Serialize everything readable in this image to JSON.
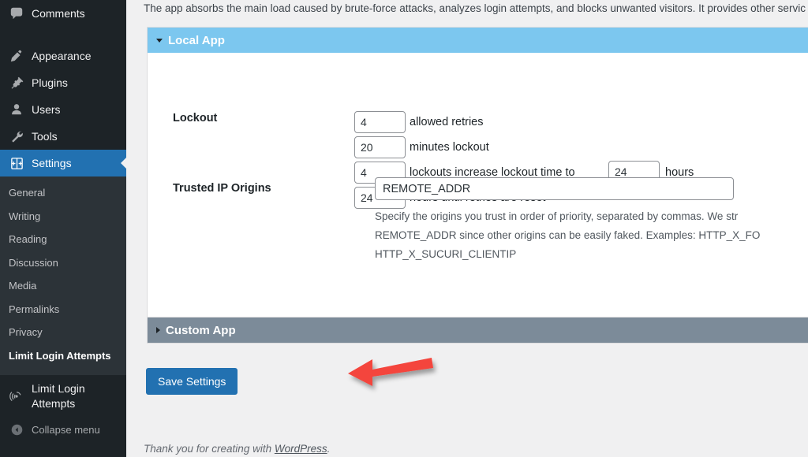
{
  "sidebar": {
    "items": [
      {
        "label": "Comments",
        "icon": "comments-icon"
      },
      {
        "label": "Appearance",
        "icon": "appearance-icon"
      },
      {
        "label": "Plugins",
        "icon": "plugins-icon"
      },
      {
        "label": "Users",
        "icon": "users-icon"
      },
      {
        "label": "Tools",
        "icon": "tools-icon"
      },
      {
        "label": "Settings",
        "icon": "settings-icon"
      }
    ],
    "submenu": [
      {
        "label": "General"
      },
      {
        "label": "Writing"
      },
      {
        "label": "Reading"
      },
      {
        "label": "Discussion"
      },
      {
        "label": "Media"
      },
      {
        "label": "Permalinks"
      },
      {
        "label": "Privacy"
      },
      {
        "label": "Limit Login Attempts"
      }
    ],
    "plugin_menu": {
      "label": "Limit Login Attempts",
      "icon": "fingerprint-icon"
    },
    "collapse": {
      "label": "Collapse menu",
      "icon": "collapse-arrow-icon"
    },
    "active_item": "Settings",
    "current_submenu": "Limit Login Attempts",
    "accent": "#2271b1",
    "background": "#1d2327"
  },
  "main": {
    "intro": "The app absorbs the main load caused by brute-force attacks, analyzes login attempts, and blocks unwanted visitors. It provides other servic",
    "panels": [
      {
        "title": "Local App",
        "state": "expanded",
        "header_color": "#7cc7ef",
        "toggle_icon": "chevron-down-icon"
      },
      {
        "title": "Custom App",
        "state": "collapsed",
        "header_color": "#7c8b99",
        "toggle_icon": "chevron-right-icon"
      }
    ],
    "lockout": {
      "label": "Lockout",
      "rows": [
        {
          "value": "4",
          "text_after": "allowed retries"
        },
        {
          "value": "20",
          "text_after": "minutes lockout"
        },
        {
          "value": "4",
          "text_after": "lockouts increase lockout time to",
          "value2": "24",
          "text_end": "hours"
        },
        {
          "value": "24",
          "text_after": "hours until retries are reset"
        }
      ]
    },
    "trusted": {
      "label": "Trusted IP Origins",
      "value": "REMOTE_ADDR",
      "placeholder": "REMOTE_ADDR",
      "description_lines": [
        "Specify the origins you trust in order of priority, separated by commas. We str",
        "REMOTE_ADDR since other origins can be easily faked. Examples: HTTP_X_FO",
        "HTTP_X_SUCURI_CLIENTIP"
      ]
    },
    "save_label": "Save Settings",
    "save_color": "#2271b1"
  },
  "annotation": {
    "type": "arrow",
    "color": "#f4443c",
    "points_to": "Save Settings"
  },
  "footer": {
    "prefix": "Thank you for creating with ",
    "link": "WordPress",
    "suffix": "."
  }
}
